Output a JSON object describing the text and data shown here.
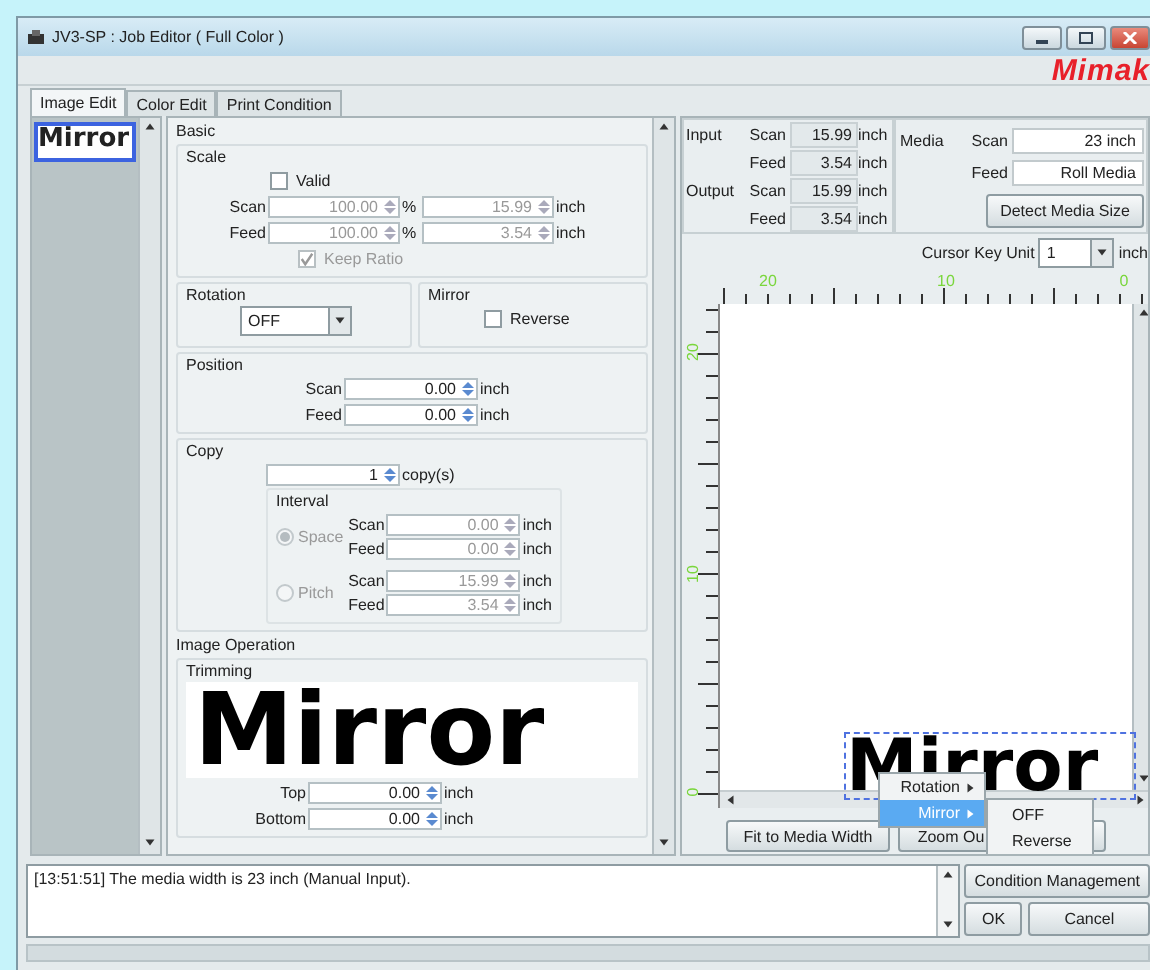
{
  "window": {
    "title": "JV3-SP : Job Editor ( Full Color )",
    "logo": "Mimak"
  },
  "tabs": [
    {
      "label": "Image Edit",
      "selected": true
    },
    {
      "label": "Color Edit",
      "selected": false
    },
    {
      "label": "Print Condition",
      "selected": false
    }
  ],
  "thumbnails": [
    {
      "text": "Mirror",
      "selected": true
    }
  ],
  "basic": {
    "title": "Basic",
    "scale": {
      "title": "Scale",
      "valid": {
        "label": "Valid",
        "checked": false
      },
      "rows": [
        {
          "label": "Scan",
          "percent": "100.00",
          "percent_unit": "%",
          "size": "15.99",
          "unit": "inch"
        },
        {
          "label": "Feed",
          "percent": "100.00",
          "percent_unit": "%",
          "size": "3.54",
          "unit": "inch"
        }
      ],
      "keep_ratio": {
        "label": "Keep Ratio",
        "checked": true
      }
    },
    "rotation": {
      "title": "Rotation",
      "value": "OFF"
    },
    "mirror": {
      "title": "Mirror",
      "reverse": {
        "label": "Reverse",
        "checked": false
      }
    },
    "position": {
      "title": "Position",
      "rows": [
        {
          "label": "Scan",
          "value": "0.00",
          "unit": "inch"
        },
        {
          "label": "Feed",
          "value": "0.00",
          "unit": "inch"
        }
      ]
    },
    "copy": {
      "title": "Copy",
      "count": "1",
      "unit": "copy(s)",
      "interval": {
        "title": "Interval",
        "disabled": true,
        "options": [
          {
            "label": "Space",
            "selected": true,
            "rows": [
              {
                "label": "Scan",
                "value": "0.00",
                "unit": "inch"
              },
              {
                "label": "Feed",
                "value": "0.00",
                "unit": "inch"
              }
            ]
          },
          {
            "label": "Pitch",
            "selected": false,
            "rows": [
              {
                "label": "Scan",
                "value": "15.99",
                "unit": "inch"
              },
              {
                "label": "Feed",
                "value": "3.54",
                "unit": "inch"
              }
            ]
          }
        ]
      }
    }
  },
  "image_operation": {
    "title": "Image Operation",
    "trimming": {
      "title": "Trimming",
      "preview_text": "Mirror",
      "rows": [
        {
          "label": "Top",
          "value": "0.00",
          "unit": "inch"
        },
        {
          "label": "Bottom",
          "value": "0.00",
          "unit": "inch"
        }
      ]
    }
  },
  "size_info": [
    {
      "group": "Input",
      "label": "Scan",
      "value": "15.99",
      "unit": "inch"
    },
    {
      "label": "Feed",
      "value": "3.54",
      "unit": "inch"
    },
    {
      "group": "Output",
      "label": "Scan",
      "value": "15.99",
      "unit": "inch"
    },
    {
      "label": "Feed",
      "value": "3.54",
      "unit": "inch"
    }
  ],
  "media": {
    "label": "Media",
    "rows": [
      {
        "label": "Scan",
        "value": "23 inch"
      },
      {
        "label": "Feed",
        "value": "Roll Media"
      }
    ],
    "detect_button": "Detect Media Size"
  },
  "cursor_key_unit": {
    "label": "Cursor Key Unit",
    "value": "1",
    "unit": "inch"
  },
  "canvas": {
    "top_ruler": [
      "20",
      "10",
      "0"
    ],
    "left_ruler": [
      "20",
      "10",
      "0"
    ],
    "image_text": "Mirror"
  },
  "context_menu": {
    "items": [
      {
        "label": "Rotation",
        "selected": false
      },
      {
        "label": "Mirror",
        "selected": true
      }
    ],
    "submenu": [
      "OFF",
      "Reverse"
    ]
  },
  "canvas_buttons": [
    "Fit to Media Width",
    "Zoom Ou"
  ],
  "log": [
    "[13:51:51] The media width is 23 inch (Manual Input)."
  ],
  "buttons": {
    "condition": "Condition Management",
    "ok": "OK",
    "cancel": "Cancel"
  }
}
